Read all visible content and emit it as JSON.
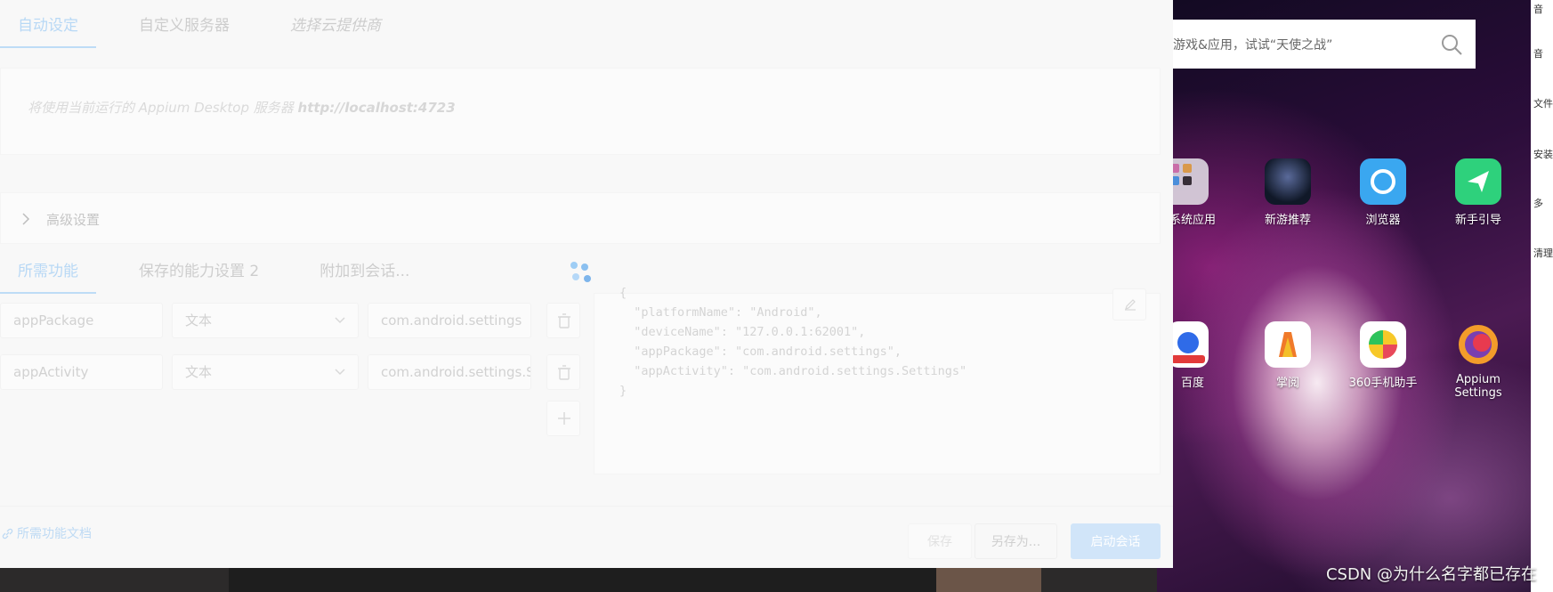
{
  "dialog": {
    "top_tabs": [
      {
        "label": "自动设定",
        "active": true
      },
      {
        "label": "自定义服务器",
        "active": false
      },
      {
        "label": "选择云提供商",
        "active": false
      }
    ],
    "server_info": {
      "prefix": "将使用当前运行的 Appium Desktop 服务器 ",
      "url": "http://localhost:4723"
    },
    "advanced_label": "高级设置",
    "capability_tabs": [
      {
        "label": "所需功能",
        "active": true
      },
      {
        "label": "保存的能力设置 2",
        "active": false
      },
      {
        "label": "附加到会话...",
        "active": false
      }
    ],
    "capabilities": [
      {
        "name": "appPackage",
        "type": "文本",
        "value": "com.android.settings"
      },
      {
        "name": "appActivity",
        "type": "文本",
        "value": "com.android.settings.Settings"
      }
    ],
    "json_preview": "{\n  \"platformName\": \"Android\",\n  \"deviceName\": \"127.0.0.1:62001\",\n  \"appPackage\": \"com.android.settings\",\n  \"appActivity\": \"com.android.settings.Settings\"\n}",
    "docs_link": "所需功能文档",
    "buttons": {
      "save": "保存",
      "save_as": "另存为...",
      "start": "启动会话"
    },
    "accent_color": "#9cc9f2"
  },
  "emulator": {
    "search_placeholder": "游戏&应用，试试“天使之战”",
    "apps_row1": [
      {
        "label": "系统应用",
        "icon": "folder-icon"
      },
      {
        "label": "新游推荐",
        "icon": "galaxy-game-icon"
      },
      {
        "label": "浏览器",
        "icon": "browser-icon"
      },
      {
        "label": "新手引导",
        "icon": "guide-icon"
      }
    ],
    "apps_row2": [
      {
        "label": "百度",
        "icon": "baidu-icon"
      },
      {
        "label": "掌阅",
        "icon": "zhangyue-icon"
      },
      {
        "label": "360手机助手",
        "icon": "360-icon"
      },
      {
        "label": "Appium Settings",
        "icon": "appium-icon"
      }
    ],
    "sidebar_items": [
      "音",
      "音",
      "文件",
      "安装",
      "多",
      "清理"
    ]
  },
  "watermark": "CSDN @为什么名字都已存在"
}
